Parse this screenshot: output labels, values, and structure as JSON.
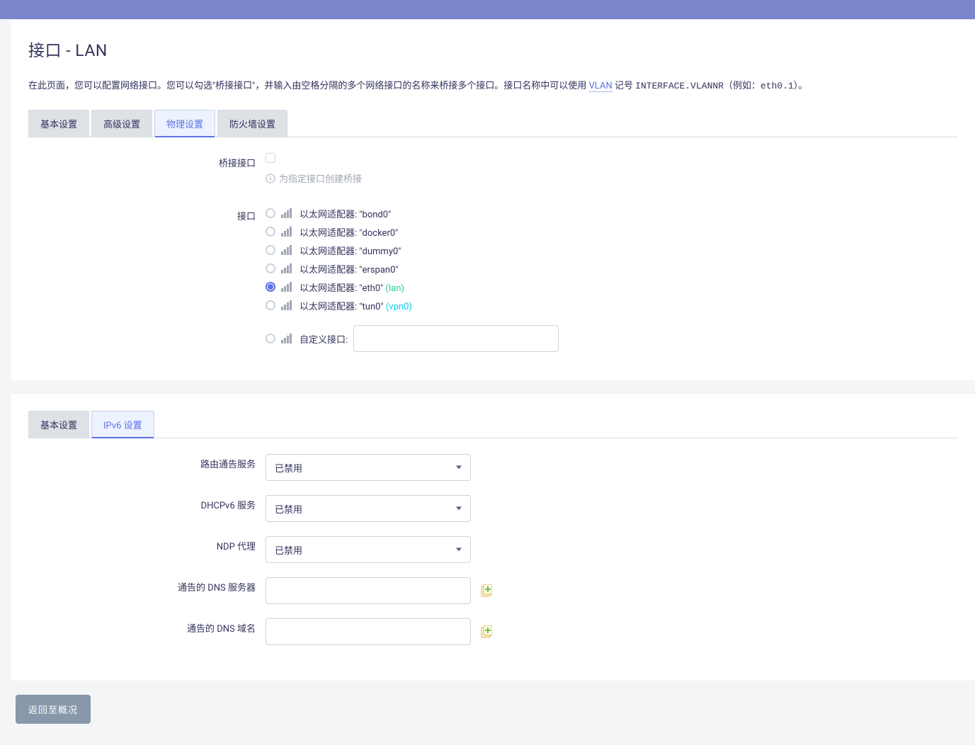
{
  "header": {
    "title": "接口 - LAN"
  },
  "intro": {
    "pre": "在此页面，您可以配置网络接口。您可以勾选\"桥接接口\"，并输入由空格分隔的多个网络接口的名称来桥接多个接口。接口名称中可以使用 ",
    "vlan": "VLAN",
    "mid": " 记号 ",
    "notation": "INTERFACE.VLANNR",
    "example_prefix": "（例如：",
    "example": "eth0.1",
    "example_suffix": "）。"
  },
  "tabs1": [
    {
      "label": "基本设置",
      "active": false
    },
    {
      "label": "高级设置",
      "active": false
    },
    {
      "label": "物理设置",
      "active": true
    },
    {
      "label": "防火墙设置",
      "active": false
    }
  ],
  "bridge": {
    "label": "桥接接口",
    "hint": "为指定接口创建桥接"
  },
  "interface": {
    "label": "接口",
    "items": [
      {
        "text": "以太网适配器: \"bond0\"",
        "checked": false,
        "alias": ""
      },
      {
        "text": "以太网适配器: \"docker0\"",
        "checked": false,
        "alias": ""
      },
      {
        "text": "以太网适配器: \"dummy0\"",
        "checked": false,
        "alias": ""
      },
      {
        "text": "以太网适配器: \"erspan0\"",
        "checked": false,
        "alias": ""
      },
      {
        "text": "以太网适配器: \"eth0\" ",
        "checked": true,
        "alias": "(lan)",
        "aliasClass": "green"
      },
      {
        "text": "以太网适配器: \"tun0\" ",
        "checked": false,
        "alias": "(vpn0)",
        "aliasClass": "teal"
      }
    ],
    "custom_label": "自定义接口:",
    "custom_value": ""
  },
  "tabs2": [
    {
      "label": "基本设置",
      "active": false
    },
    {
      "label": "IPv6 设置",
      "active": true
    }
  ],
  "ipv6": {
    "ra": {
      "label": "路由通告服务",
      "value": "已禁用"
    },
    "dhcp": {
      "label": "DHCPv6 服务",
      "value": "已禁用"
    },
    "ndp": {
      "label": "NDP 代理",
      "value": "已禁用"
    },
    "dns": {
      "label": "通告的 DNS 服务器",
      "value": ""
    },
    "dom": {
      "label": "通告的 DNS 域名",
      "value": ""
    }
  },
  "back": "返回至概况"
}
